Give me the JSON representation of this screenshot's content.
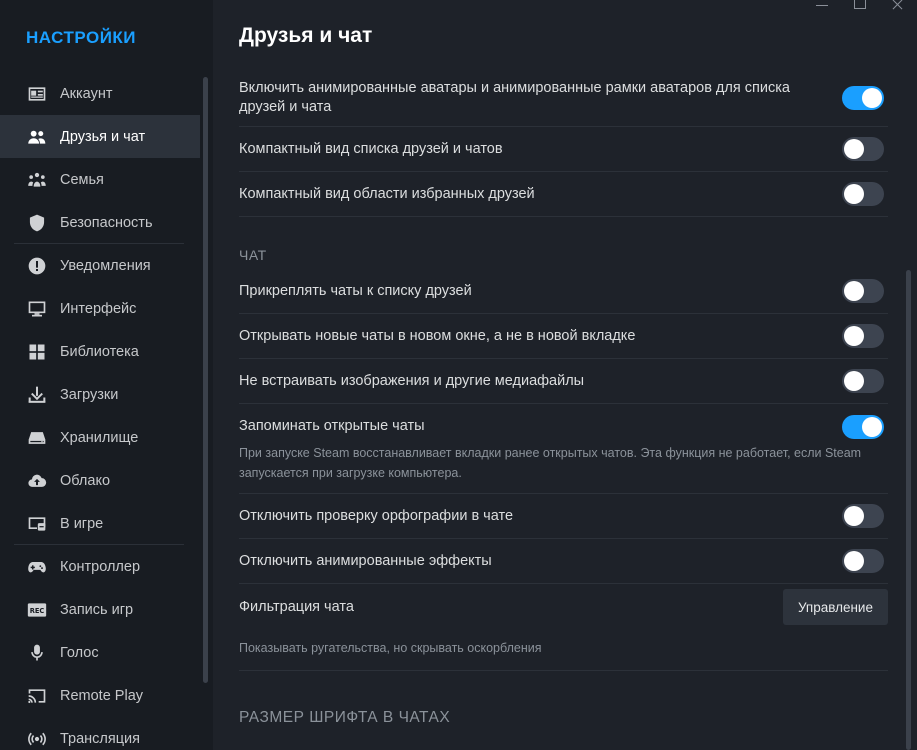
{
  "sidebar": {
    "title": "НАСТРОЙКИ",
    "items": [
      {
        "label": "Аккаунт",
        "icon": "account-card-icon",
        "active": false,
        "divider": false
      },
      {
        "label": "Друзья и чат",
        "icon": "friends-icon",
        "active": true,
        "divider": false
      },
      {
        "label": "Семья",
        "icon": "family-icon",
        "active": false,
        "divider": false
      },
      {
        "label": "Безопасность",
        "icon": "shield-icon",
        "active": false,
        "divider": true
      },
      {
        "label": "Уведомления",
        "icon": "alert-icon",
        "active": false,
        "divider": false
      },
      {
        "label": "Интерфейс",
        "icon": "monitor-icon",
        "active": false,
        "divider": false
      },
      {
        "label": "Библиотека",
        "icon": "grid-icon",
        "active": false,
        "divider": false
      },
      {
        "label": "Загрузки",
        "icon": "download-icon",
        "active": false,
        "divider": false
      },
      {
        "label": "Хранилище",
        "icon": "storage-icon",
        "active": false,
        "divider": false
      },
      {
        "label": "Облако",
        "icon": "cloud-icon",
        "active": false,
        "divider": false
      },
      {
        "label": "В игре",
        "icon": "in-game-icon",
        "active": false,
        "divider": true
      },
      {
        "label": "Контроллер",
        "icon": "gamepad-icon",
        "active": false,
        "divider": false
      },
      {
        "label": "Запись игр",
        "icon": "rec-icon",
        "active": false,
        "divider": false
      },
      {
        "label": "Голос",
        "icon": "microphone-icon",
        "active": false,
        "divider": false
      },
      {
        "label": "Remote Play",
        "icon": "cast-icon",
        "active": false,
        "divider": false
      },
      {
        "label": "Трансляция",
        "icon": "broadcast-icon",
        "active": false,
        "divider": false
      }
    ]
  },
  "main": {
    "title": "Друзья и чат",
    "settings_top": [
      {
        "label": "Включить анимированные аватары и анимированные рамки аватаров для списка друзей и чата",
        "on": true
      },
      {
        "label": "Компактный вид списка друзей и чатов",
        "on": false
      },
      {
        "label": "Компактный вид области избранных друзей",
        "on": false
      }
    ],
    "chat_section": {
      "header": "ЧАТ",
      "settings": [
        {
          "label": "Прикреплять чаты к списку друзей",
          "on": false
        },
        {
          "label": "Открывать новые чаты в новом окне, а не в новой вкладке",
          "on": false
        },
        {
          "label": "Не встраивать изображения и другие медиафайлы",
          "on": false
        }
      ],
      "remember": {
        "label": "Запоминать открытые чаты",
        "on": true,
        "description": "При запуске Steam восстанавливает вкладки ранее открытых чатов. Эта функция не работает, если Steam запускается при загрузке компьютера."
      },
      "settings_after": [
        {
          "label": "Отключить проверку орфографии в чате",
          "on": false
        },
        {
          "label": "Отключить анимированные эффекты",
          "on": false
        }
      ],
      "filter": {
        "label": "Фильтрация чата",
        "button": "Управление",
        "description": "Показывать ругательства, но скрывать оскорбления"
      }
    },
    "font_section": {
      "header": "РАЗМЕР ШРИФТА В ЧАТАХ"
    }
  },
  "colors": {
    "accent": "#1a9fff",
    "toggle_off": "#3d4450",
    "sidebar_bg": "#181c22",
    "main_bg": "#1e2229"
  }
}
